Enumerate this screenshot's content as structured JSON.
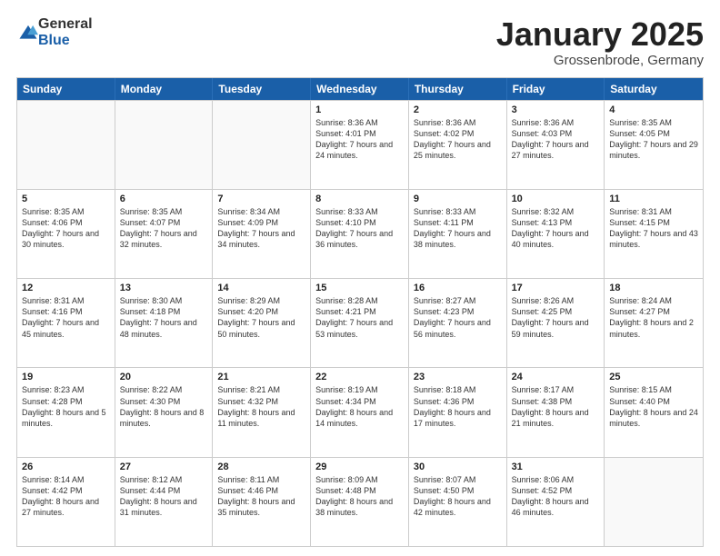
{
  "logo": {
    "general": "General",
    "blue": "Blue"
  },
  "title": {
    "month": "January 2025",
    "location": "Grossenbrode, Germany"
  },
  "header_days": [
    "Sunday",
    "Monday",
    "Tuesday",
    "Wednesday",
    "Thursday",
    "Friday",
    "Saturday"
  ],
  "weeks": [
    [
      {
        "day": "",
        "info": "",
        "empty": true
      },
      {
        "day": "",
        "info": "",
        "empty": true
      },
      {
        "day": "",
        "info": "",
        "empty": true
      },
      {
        "day": "1",
        "info": "Sunrise: 8:36 AM\nSunset: 4:01 PM\nDaylight: 7 hours\nand 24 minutes.",
        "empty": false
      },
      {
        "day": "2",
        "info": "Sunrise: 8:36 AM\nSunset: 4:02 PM\nDaylight: 7 hours\nand 25 minutes.",
        "empty": false
      },
      {
        "day": "3",
        "info": "Sunrise: 8:36 AM\nSunset: 4:03 PM\nDaylight: 7 hours\nand 27 minutes.",
        "empty": false
      },
      {
        "day": "4",
        "info": "Sunrise: 8:35 AM\nSunset: 4:05 PM\nDaylight: 7 hours\nand 29 minutes.",
        "empty": false
      }
    ],
    [
      {
        "day": "5",
        "info": "Sunrise: 8:35 AM\nSunset: 4:06 PM\nDaylight: 7 hours\nand 30 minutes.",
        "empty": false
      },
      {
        "day": "6",
        "info": "Sunrise: 8:35 AM\nSunset: 4:07 PM\nDaylight: 7 hours\nand 32 minutes.",
        "empty": false
      },
      {
        "day": "7",
        "info": "Sunrise: 8:34 AM\nSunset: 4:09 PM\nDaylight: 7 hours\nand 34 minutes.",
        "empty": false
      },
      {
        "day": "8",
        "info": "Sunrise: 8:33 AM\nSunset: 4:10 PM\nDaylight: 7 hours\nand 36 minutes.",
        "empty": false
      },
      {
        "day": "9",
        "info": "Sunrise: 8:33 AM\nSunset: 4:11 PM\nDaylight: 7 hours\nand 38 minutes.",
        "empty": false
      },
      {
        "day": "10",
        "info": "Sunrise: 8:32 AM\nSunset: 4:13 PM\nDaylight: 7 hours\nand 40 minutes.",
        "empty": false
      },
      {
        "day": "11",
        "info": "Sunrise: 8:31 AM\nSunset: 4:15 PM\nDaylight: 7 hours\nand 43 minutes.",
        "empty": false
      }
    ],
    [
      {
        "day": "12",
        "info": "Sunrise: 8:31 AM\nSunset: 4:16 PM\nDaylight: 7 hours\nand 45 minutes.",
        "empty": false
      },
      {
        "day": "13",
        "info": "Sunrise: 8:30 AM\nSunset: 4:18 PM\nDaylight: 7 hours\nand 48 minutes.",
        "empty": false
      },
      {
        "day": "14",
        "info": "Sunrise: 8:29 AM\nSunset: 4:20 PM\nDaylight: 7 hours\nand 50 minutes.",
        "empty": false
      },
      {
        "day": "15",
        "info": "Sunrise: 8:28 AM\nSunset: 4:21 PM\nDaylight: 7 hours\nand 53 minutes.",
        "empty": false
      },
      {
        "day": "16",
        "info": "Sunrise: 8:27 AM\nSunset: 4:23 PM\nDaylight: 7 hours\nand 56 minutes.",
        "empty": false
      },
      {
        "day": "17",
        "info": "Sunrise: 8:26 AM\nSunset: 4:25 PM\nDaylight: 7 hours\nand 59 minutes.",
        "empty": false
      },
      {
        "day": "18",
        "info": "Sunrise: 8:24 AM\nSunset: 4:27 PM\nDaylight: 8 hours\nand 2 minutes.",
        "empty": false
      }
    ],
    [
      {
        "day": "19",
        "info": "Sunrise: 8:23 AM\nSunset: 4:28 PM\nDaylight: 8 hours\nand 5 minutes.",
        "empty": false
      },
      {
        "day": "20",
        "info": "Sunrise: 8:22 AM\nSunset: 4:30 PM\nDaylight: 8 hours\nand 8 minutes.",
        "empty": false
      },
      {
        "day": "21",
        "info": "Sunrise: 8:21 AM\nSunset: 4:32 PM\nDaylight: 8 hours\nand 11 minutes.",
        "empty": false
      },
      {
        "day": "22",
        "info": "Sunrise: 8:19 AM\nSunset: 4:34 PM\nDaylight: 8 hours\nand 14 minutes.",
        "empty": false
      },
      {
        "day": "23",
        "info": "Sunrise: 8:18 AM\nSunset: 4:36 PM\nDaylight: 8 hours\nand 17 minutes.",
        "empty": false
      },
      {
        "day": "24",
        "info": "Sunrise: 8:17 AM\nSunset: 4:38 PM\nDaylight: 8 hours\nand 21 minutes.",
        "empty": false
      },
      {
        "day": "25",
        "info": "Sunrise: 8:15 AM\nSunset: 4:40 PM\nDaylight: 8 hours\nand 24 minutes.",
        "empty": false
      }
    ],
    [
      {
        "day": "26",
        "info": "Sunrise: 8:14 AM\nSunset: 4:42 PM\nDaylight: 8 hours\nand 27 minutes.",
        "empty": false
      },
      {
        "day": "27",
        "info": "Sunrise: 8:12 AM\nSunset: 4:44 PM\nDaylight: 8 hours\nand 31 minutes.",
        "empty": false
      },
      {
        "day": "28",
        "info": "Sunrise: 8:11 AM\nSunset: 4:46 PM\nDaylight: 8 hours\nand 35 minutes.",
        "empty": false
      },
      {
        "day": "29",
        "info": "Sunrise: 8:09 AM\nSunset: 4:48 PM\nDaylight: 8 hours\nand 38 minutes.",
        "empty": false
      },
      {
        "day": "30",
        "info": "Sunrise: 8:07 AM\nSunset: 4:50 PM\nDaylight: 8 hours\nand 42 minutes.",
        "empty": false
      },
      {
        "day": "31",
        "info": "Sunrise: 8:06 AM\nSunset: 4:52 PM\nDaylight: 8 hours\nand 46 minutes.",
        "empty": false
      },
      {
        "day": "",
        "info": "",
        "empty": true
      }
    ]
  ]
}
